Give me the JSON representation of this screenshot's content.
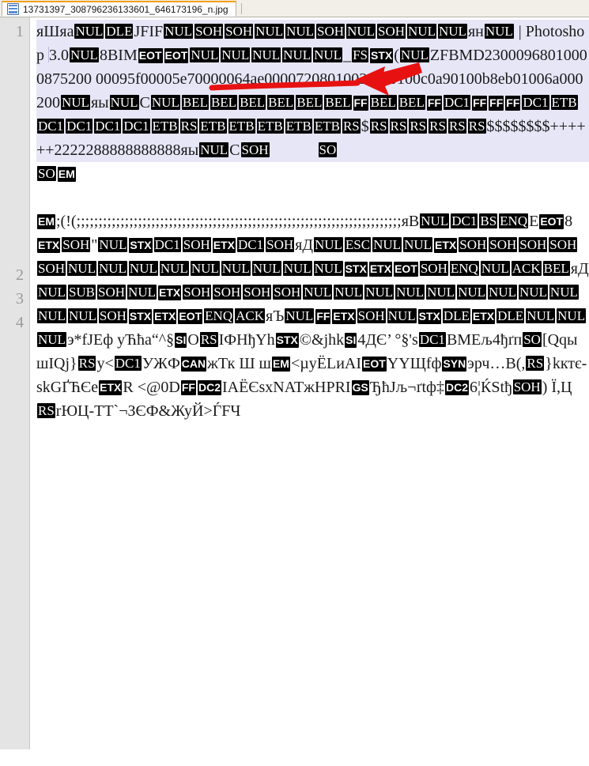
{
  "window": {
    "tab": {
      "icon": "document-icon",
      "filename": "13731397_308796236133601_646173196_n.jpg"
    }
  },
  "editor": {
    "gutter_numbers": [
      "1",
      "2",
      "3",
      "4"
    ],
    "annotation": {
      "color": "#e81111",
      "shapes": [
        "underline-stroke",
        "left-arrow"
      ],
      "points_at": "Photoshop"
    },
    "selection_color": "#e6e6f7",
    "control_char_bg": "#000000",
    "control_char_fg": "#ffffff",
    "lines": [
      {
        "number": "1",
        "selected": true,
        "tokens": [
          {
            "t": "text",
            "v": "яШяа"
          },
          {
            "t": "cc",
            "v": "NUL"
          },
          {
            "t": "cc",
            "v": "DLE"
          },
          {
            "t": "text",
            "v": "JFIF"
          },
          {
            "t": "cc",
            "v": "NUL"
          },
          {
            "t": "cc",
            "v": "SOH"
          },
          {
            "t": "cc",
            "v": "SOH"
          },
          {
            "t": "cc",
            "v": "NUL"
          },
          {
            "t": "cc",
            "v": "NUL"
          },
          {
            "t": "cc",
            "v": "SOH"
          },
          {
            "t": "cc",
            "v": "NUL"
          },
          {
            "t": "cc",
            "v": "SOH"
          },
          {
            "t": "cc",
            "v": "NUL"
          },
          {
            "t": "cc",
            "v": "NUL"
          },
          {
            "t": "text",
            "v": "ян"
          },
          {
            "t": "cc",
            "v": "NUL"
          },
          {
            "t": "text",
            "v": " | Photoshop "
          },
          {
            "t": "vline",
            "v": ""
          },
          {
            "t": "text",
            "v": "3.0"
          },
          {
            "t": "cc",
            "v": "NUL"
          },
          {
            "t": "text",
            "v": "8BIM"
          },
          {
            "t": "cc",
            "v": "EOT"
          },
          {
            "t": "cc",
            "v": "EOT"
          },
          {
            "t": "cc",
            "v": "NUL"
          },
          {
            "t": "cc",
            "v": "NUL"
          },
          {
            "t": "cc",
            "v": "NUL"
          },
          {
            "t": "cc",
            "v": "NUL"
          },
          {
            "t": "cc",
            "v": "NUL"
          },
          {
            "t": "text",
            "v": "_"
          },
          {
            "t": "cc",
            "v": "FS"
          },
          {
            "t": "cc",
            "v": "STX"
          },
          {
            "t": "text",
            "v": "("
          },
          {
            "t": "cc",
            "v": "NUL"
          },
          {
            "t": "text",
            "v": "ZFBMD23000968010000875200 00095f00005e70000064ae0000720801003a1a0100c0a90100b8eb01006a000200"
          },
          {
            "t": "cc",
            "v": "NUL"
          },
          {
            "t": "text",
            "v": "яы"
          },
          {
            "t": "cc",
            "v": "NUL"
          },
          {
            "t": "text",
            "v": "C"
          },
          {
            "t": "cc",
            "v": "NUL"
          },
          {
            "t": "cc",
            "v": "BEL"
          },
          {
            "t": "cc",
            "v": "BEL"
          },
          {
            "t": "cc",
            "v": "BEL"
          },
          {
            "t": "cc",
            "v": "BEL"
          },
          {
            "t": "cc",
            "v": "BEL"
          },
          {
            "t": "cc",
            "v": "BEL"
          },
          {
            "t": "cc",
            "v": "FF"
          },
          {
            "t": "cc",
            "v": "BEL"
          },
          {
            "t": "cc",
            "v": "BEL"
          },
          {
            "t": "cc",
            "v": "FF"
          },
          {
            "t": "cc",
            "v": "DC1"
          },
          {
            "t": "cc",
            "v": "FF"
          },
          {
            "t": "cc",
            "v": "FF"
          },
          {
            "t": "cc",
            "v": "FF"
          },
          {
            "t": "cc",
            "v": "DC1"
          },
          {
            "t": "cc",
            "v": "ETB"
          },
          {
            "t": "cc",
            "v": "DC1"
          },
          {
            "t": "cc",
            "v": "DC1"
          },
          {
            "t": "cc",
            "v": "DC1"
          },
          {
            "t": "cc",
            "v": "DC1"
          },
          {
            "t": "cc",
            "v": "ETB"
          },
          {
            "t": "cc",
            "v": "RS"
          },
          {
            "t": "cc",
            "v": "ETB"
          },
          {
            "t": "cc",
            "v": "ETB"
          },
          {
            "t": "cc",
            "v": "ETB"
          },
          {
            "t": "cc",
            "v": "ETB"
          },
          {
            "t": "cc",
            "v": "ETB"
          },
          {
            "t": "cc",
            "v": "RS"
          },
          {
            "t": "text",
            "v": "$"
          },
          {
            "t": "cc",
            "v": "RS"
          },
          {
            "t": "cc",
            "v": "RS"
          },
          {
            "t": "cc",
            "v": "RS"
          },
          {
            "t": "cc",
            "v": "RS"
          },
          {
            "t": "cc",
            "v": "RS"
          },
          {
            "t": "cc",
            "v": "RS"
          },
          {
            "t": "text",
            "v": "$$$$$$$$++++++2222288888888888яы"
          },
          {
            "t": "cc",
            "v": "NUL"
          },
          {
            "t": "text",
            "v": "C"
          },
          {
            "t": "cc",
            "v": "SOH"
          },
          {
            "t": "sp",
            "v": "            "
          },
          {
            "t": "cc",
            "v": "SO"
          }
        ]
      },
      {
        "number": "2",
        "selected": false,
        "tokens": [
          {
            "t": "cc",
            "v": "SO"
          },
          {
            "t": "cc",
            "v": "EM"
          }
        ]
      },
      {
        "number": "3",
        "selected": false,
        "tokens": []
      },
      {
        "number": "4",
        "selected": false,
        "tokens": [
          {
            "t": "cc",
            "v": "EM"
          },
          {
            "t": "text",
            "v": ";(!(;;;;;;;;;;;;;;;;;;;;;;;;;;;;;;;;;;;;;;;;;;;;;;;;;;;;;;;;;;;;;;;;;;;;;;;;;;яB"
          },
          {
            "t": "cc",
            "v": "NUL"
          },
          {
            "t": "cc",
            "v": "DC1"
          },
          {
            "t": "cc",
            "v": "BS"
          },
          {
            "t": "cc",
            "v": "ENQ"
          },
          {
            "t": "text",
            "v": "E"
          },
          {
            "t": "cc",
            "v": "EOT"
          },
          {
            "t": "text",
            "v": "8"
          },
          {
            "t": "cc",
            "v": "ETX"
          },
          {
            "t": "cc",
            "v": "SOH"
          },
          {
            "t": "text",
            "v": "\""
          },
          {
            "t": "cc",
            "v": "NUL"
          },
          {
            "t": "cc",
            "v": "STX"
          },
          {
            "t": "cc",
            "v": "DC1"
          },
          {
            "t": "cc",
            "v": "SOH"
          },
          {
            "t": "cc",
            "v": "ETX"
          },
          {
            "t": "cc",
            "v": "DC1"
          },
          {
            "t": "cc",
            "v": "SOH"
          },
          {
            "t": "text",
            "v": "яД"
          },
          {
            "t": "cc",
            "v": "NUL"
          },
          {
            "t": "cc",
            "v": "ESC"
          },
          {
            "t": "cc",
            "v": "NUL"
          },
          {
            "t": "cc",
            "v": "NUL"
          },
          {
            "t": "cc",
            "v": "ETX"
          },
          {
            "t": "cc",
            "v": "SOH"
          },
          {
            "t": "cc",
            "v": "SOH"
          },
          {
            "t": "cc",
            "v": "SOH"
          },
          {
            "t": "cc",
            "v": "SOH"
          },
          {
            "t": "cc",
            "v": "SOH"
          },
          {
            "t": "cc",
            "v": "NUL"
          },
          {
            "t": "cc",
            "v": "NUL"
          },
          {
            "t": "cc",
            "v": "NUL"
          },
          {
            "t": "cc",
            "v": "NUL"
          },
          {
            "t": "cc",
            "v": "NUL"
          },
          {
            "t": "cc",
            "v": "NUL"
          },
          {
            "t": "cc",
            "v": "NUL"
          },
          {
            "t": "cc",
            "v": "NUL"
          },
          {
            "t": "cc",
            "v": "NUL"
          },
          {
            "t": "cc",
            "v": "STX"
          },
          {
            "t": "cc",
            "v": "ETX"
          },
          {
            "t": "cc",
            "v": "EOT"
          },
          {
            "t": "cc",
            "v": "SOH"
          },
          {
            "t": "cc",
            "v": "ENQ"
          },
          {
            "t": "cc",
            "v": "NUL"
          },
          {
            "t": "cc",
            "v": "ACK"
          },
          {
            "t": "cc",
            "v": "BEL"
          },
          {
            "t": "text",
            "v": "яД"
          },
          {
            "t": "cc",
            "v": "NUL"
          },
          {
            "t": "cc",
            "v": "SUB"
          },
          {
            "t": "cc",
            "v": "SOH"
          },
          {
            "t": "cc",
            "v": "NUL"
          },
          {
            "t": "cc",
            "v": "ETX"
          },
          {
            "t": "cc",
            "v": "SOH"
          },
          {
            "t": "cc",
            "v": "SOH"
          },
          {
            "t": "cc",
            "v": "SOH"
          },
          {
            "t": "cc",
            "v": "SOH"
          },
          {
            "t": "cc",
            "v": "NUL"
          },
          {
            "t": "cc",
            "v": "NUL"
          },
          {
            "t": "cc",
            "v": "NUL"
          },
          {
            "t": "cc",
            "v": "NUL"
          },
          {
            "t": "cc",
            "v": "NUL"
          },
          {
            "t": "cc",
            "v": "NUL"
          },
          {
            "t": "cc",
            "v": "NUL"
          },
          {
            "t": "cc",
            "v": "NUL"
          },
          {
            "t": "cc",
            "v": "NUL"
          },
          {
            "t": "cc",
            "v": "NUL"
          },
          {
            "t": "cc",
            "v": "NUL"
          },
          {
            "t": "cc",
            "v": "SOH"
          },
          {
            "t": "cc",
            "v": "STX"
          },
          {
            "t": "cc",
            "v": "ETX"
          },
          {
            "t": "cc",
            "v": "EOT"
          },
          {
            "t": "cc",
            "v": "ENQ"
          },
          {
            "t": "cc",
            "v": "ACK"
          },
          {
            "t": "text",
            "v": "яЪ"
          },
          {
            "t": "cc",
            "v": "NUL"
          },
          {
            "t": "cc",
            "v": "FF"
          },
          {
            "t": "cc",
            "v": "ETX"
          },
          {
            "t": "cc",
            "v": "SOH"
          },
          {
            "t": "cc",
            "v": "NUL"
          },
          {
            "t": "cc",
            "v": "STX"
          },
          {
            "t": "cc",
            "v": "DLE"
          },
          {
            "t": "cc",
            "v": "ETX"
          },
          {
            "t": "cc",
            "v": "DLE"
          },
          {
            "t": "cc",
            "v": "NUL"
          },
          {
            "t": "cc",
            "v": "NUL"
          },
          {
            "t": "cc",
            "v": "NUL"
          },
          {
            "t": "text",
            "v": "э*fJEф уЋћa“^§"
          },
          {
            "t": "cc",
            "v": "SI"
          },
          {
            "t": "text",
            "v": "O"
          },
          {
            "t": "cc",
            "v": "RS"
          },
          {
            "t": "text",
            "v": "IФHђYh"
          },
          {
            "t": "cc",
            "v": "STX"
          },
          {
            "t": "text",
            "v": "©&jhk"
          },
          {
            "t": "cc",
            "v": "SI"
          },
          {
            "t": "text",
            "v": "4ДЄ’ °§'s"
          },
          {
            "t": "cc",
            "v": "DC1"
          },
          {
            "t": "text",
            "v": "BMEљ4ђґп"
          },
          {
            "t": "cc",
            "v": "SO"
          },
          {
            "t": "text",
            "v": "[QqышIQj}"
          },
          {
            "t": "cc",
            "v": "RS"
          },
          {
            "t": "text",
            "v": "y<"
          },
          {
            "t": "cc",
            "v": "DC1"
          },
          {
            "t": "text",
            "v": "УЖФ"
          },
          {
            "t": "cc",
            "v": "CAN"
          },
          {
            "t": "text",
            "v": "жТк Ш ш"
          },
          {
            "t": "cc",
            "v": "EM"
          },
          {
            "t": "text",
            "v": "<µyЁLиAI"
          },
          {
            "t": "cc",
            "v": "EOT"
          },
          {
            "t": "text",
            "v": "YYЩfф"
          },
          {
            "t": "cc",
            "v": "SYN"
          },
          {
            "t": "text",
            "v": "эрч…B(,"
          },
          {
            "t": "cc",
            "v": "RS"
          },
          {
            "t": "text",
            "v": "}kктє-skGҐЋЄe"
          },
          {
            "t": "cc",
            "v": "ETX"
          },
          {
            "t": "text",
            "v": "R <@0D"
          },
          {
            "t": "cc",
            "v": "FF"
          },
          {
            "t": "cc",
            "v": "DC2"
          },
          {
            "t": "text",
            "v": "IAЁЄsxNATжHPRI"
          },
          {
            "t": "cc",
            "v": "GS"
          },
          {
            "t": "text",
            "v": "ЂћЈљ¬ґtф‡"
          },
          {
            "t": "cc",
            "v": "DC2"
          },
          {
            "t": "text",
            "v": "6¦ЌStђ"
          },
          {
            "t": "cc",
            "v": "SOH"
          },
          {
            "t": "text",
            "v": ") Ї,Ц"
          },
          {
            "t": "cc",
            "v": "RS"
          },
          {
            "t": "text",
            "v": "rЮЦ-TT`¬ЗЄФ&ЖуЙ>ЃFЧ"
          }
        ]
      }
    ]
  }
}
